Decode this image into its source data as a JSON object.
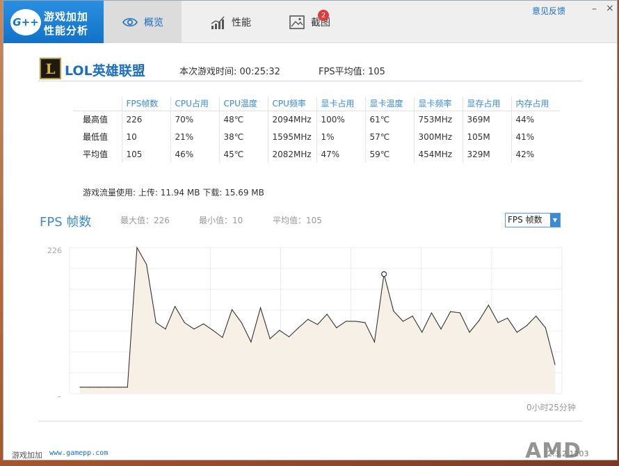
{
  "app": {
    "logo_badge": "G++",
    "logo_line1": "游戏加加",
    "logo_line2": "性能分析",
    "feedback": "意见反馈",
    "minimize": "–",
    "close": "×"
  },
  "tabs": [
    {
      "label": "概览",
      "icon": "eye-icon"
    },
    {
      "label": "性能",
      "icon": "performance-chart-icon"
    },
    {
      "label": "截图",
      "icon": "screenshot-image-icon"
    }
  ],
  "screenshot_badge": "2",
  "game": {
    "name": "LOL英雄联盟",
    "icon_letter": "L",
    "session_time": "本次游戏时间: 00:25:32",
    "fps_avg": "FPS平均值: 105"
  },
  "stats": {
    "headers": [
      "FPS帧数",
      "CPU占用",
      "CPU温度",
      "CPU频率",
      "显卡占用",
      "显卡温度",
      "显卡频率",
      "显存占用",
      "内存占用"
    ],
    "rows": [
      {
        "label": "最高值",
        "values": [
          "226",
          "70%",
          "48℃",
          "2094MHz",
          "100%",
          "61℃",
          "753MHz",
          "369M",
          "44%"
        ]
      },
      {
        "label": "最低值",
        "values": [
          "10",
          "21%",
          "38℃",
          "1595MHz",
          "1%",
          "57℃",
          "300MHz",
          "105M",
          "41%"
        ]
      },
      {
        "label": "平均值",
        "values": [
          "105",
          "46%",
          "45℃",
          "2082MHz",
          "47%",
          "59℃",
          "454MHz",
          "329M",
          "42%"
        ]
      }
    ]
  },
  "traffic": "游戏流量使用: 上传: 11.94 MB   下载: 15.69 MB",
  "fps_section": {
    "title": "FPS 帧数",
    "max": "最大值：226",
    "min": "最小值：10",
    "avg": "平均值：105",
    "select_value": "FPS 帧数",
    "duration": "0小时25分钟"
  },
  "chart_data": {
    "type": "area",
    "ylim": [
      0,
      226
    ],
    "y_tick_labels": [
      "226",
      "0"
    ],
    "grid": true,
    "line_color": "#333333",
    "fill_color": "#f7f0e6",
    "values": [
      10,
      10,
      10,
      10,
      10,
      10,
      226,
      200,
      110,
      100,
      135,
      110,
      100,
      108,
      98,
      87,
      130,
      110,
      80,
      133,
      85,
      98,
      88,
      102,
      115,
      107,
      123,
      102,
      112,
      112,
      110,
      80,
      185,
      128,
      112,
      120,
      95,
      125,
      100,
      127,
      125,
      95,
      113,
      137,
      110,
      117,
      95,
      105,
      120,
      102,
      45
    ]
  },
  "footer": {
    "brand": "游戏加加",
    "url": "www.gamepp.com",
    "amd": "AMD",
    "version": "2.3.2.1203"
  }
}
